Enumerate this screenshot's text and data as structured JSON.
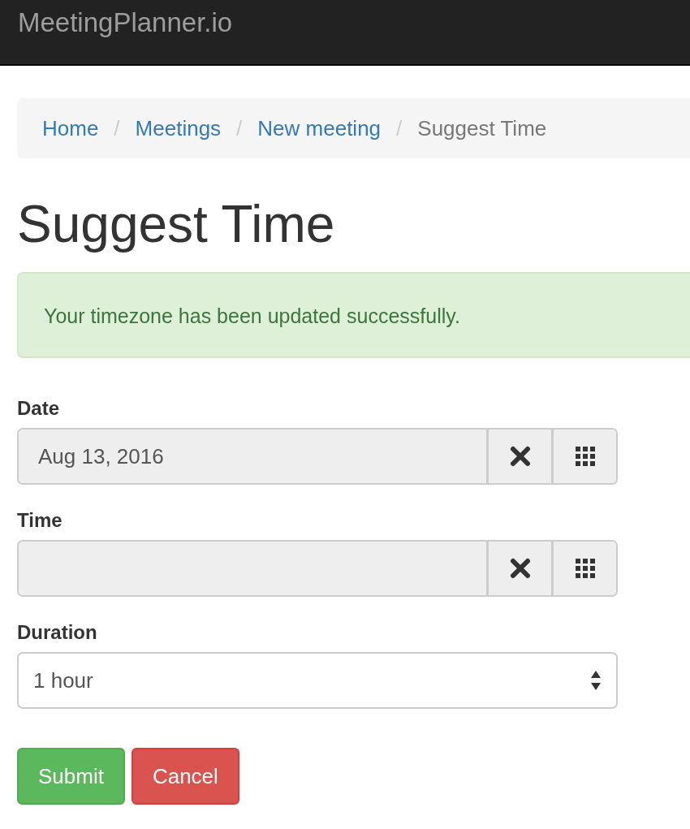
{
  "navbar": {
    "brand": "MeetingPlanner.io"
  },
  "breadcrumb_separator": "/",
  "breadcrumb": [
    {
      "label": "Home",
      "kind": "link"
    },
    {
      "label": "Meetings",
      "kind": "link"
    },
    {
      "label": "New meeting",
      "kind": "link"
    },
    {
      "label": "Suggest Time",
      "kind": "current"
    }
  ],
  "heading": "Suggest Time",
  "alert": {
    "message": "Your timezone has been updated successfully."
  },
  "fields": [
    {
      "label": "Date",
      "kind": "picker",
      "value": "Aug 13, 2016"
    },
    {
      "label": "Time",
      "kind": "picker"
    },
    {
      "label": "Duration",
      "kind": "select",
      "value": "1 hour"
    }
  ],
  "buttons": [
    {
      "label": "Submit",
      "kind": "success"
    },
    {
      "label": "Cancel",
      "kind": "danger"
    }
  ]
}
